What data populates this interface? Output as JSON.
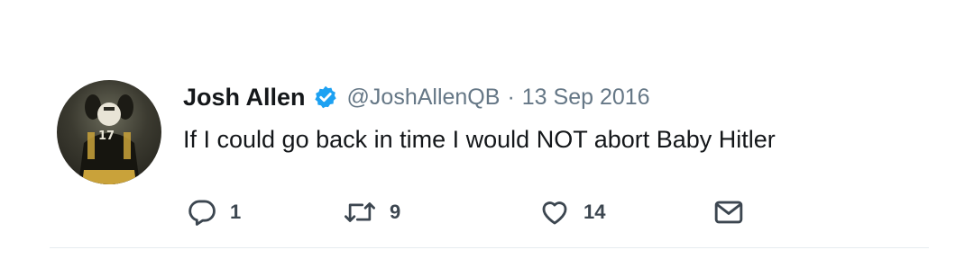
{
  "tweet": {
    "author_name": "Josh Allen",
    "handle": "@JoshAllenQB",
    "separator": "·",
    "date": "13 Sep 2016",
    "text": "If I could go back in time I would NOT abort Baby Hitler",
    "avatar_jersey_number": "17"
  },
  "actions": {
    "reply_count": "1",
    "retweet_count": "9",
    "like_count": "14"
  },
  "icons": {
    "verified": "verified-badge-icon",
    "reply": "reply-icon",
    "retweet": "retweet-icon",
    "like": "heart-icon",
    "dm": "envelope-icon"
  },
  "colors": {
    "verified_blue": "#1da1f2",
    "text_primary": "#14171a",
    "text_secondary": "#657786"
  }
}
